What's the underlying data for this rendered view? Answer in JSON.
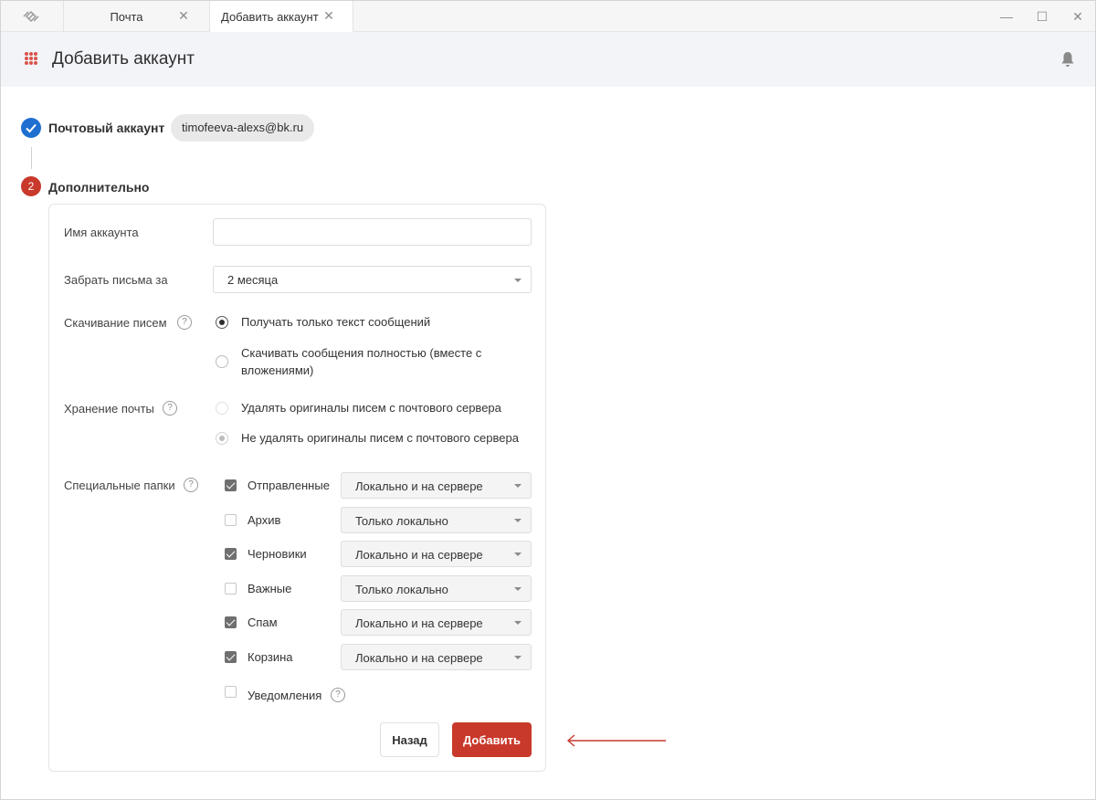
{
  "tabs": [
    {
      "label": "Почта"
    },
    {
      "label": "Добавить аккаунт"
    }
  ],
  "header": {
    "title": "Добавить аккаунт"
  },
  "stepper": {
    "step1": {
      "label": "Почтовый аккаунт",
      "email": "timofeeva-alexs@bk.ru"
    },
    "step2": {
      "number": "2",
      "label": "Дополнительно"
    }
  },
  "form": {
    "account_name": {
      "label": "Имя аккаунта",
      "value": ""
    },
    "fetch_period": {
      "label": "Забрать письма за",
      "value": "2 месяца"
    },
    "download": {
      "label": "Скачивание писем",
      "help": "?",
      "options": [
        {
          "label": "Получать только текст сообщений",
          "checked": true
        },
        {
          "label_line1": "Скачивать сообщения полностью (вместе с",
          "label_line2": "вложениями)",
          "checked": false
        }
      ]
    },
    "storage": {
      "label": "Хранение почты",
      "help": "?",
      "options": [
        {
          "label": "Удалять оригиналы писем с почтового сервера",
          "checked": false
        },
        {
          "label": "Не удалять оригиналы писем с почтового сервера",
          "checked": true
        }
      ]
    },
    "folders": {
      "label": "Специальные папки",
      "help": "?",
      "items": [
        {
          "label": "Отправленные",
          "checked": true,
          "mode": "Локально и на сервере"
        },
        {
          "label": "Архив",
          "checked": false,
          "mode": "Только локально"
        },
        {
          "label": "Черновики",
          "checked": true,
          "mode": "Локально и на сервере"
        },
        {
          "label": "Важные",
          "checked": false,
          "mode": "Только локально"
        },
        {
          "label": "Спам",
          "checked": true,
          "mode": "Локально и на сервере"
        },
        {
          "label": "Корзина",
          "checked": true,
          "mode": "Локально и на сервере"
        }
      ],
      "notifications": {
        "label": "Уведомления",
        "checked": false,
        "help": "?"
      }
    }
  },
  "buttons": {
    "back": "Назад",
    "add": "Добавить"
  },
  "colors": {
    "accent": "#c9392b",
    "step_done": "#1f6fd1",
    "arrow": "#c9392b"
  }
}
